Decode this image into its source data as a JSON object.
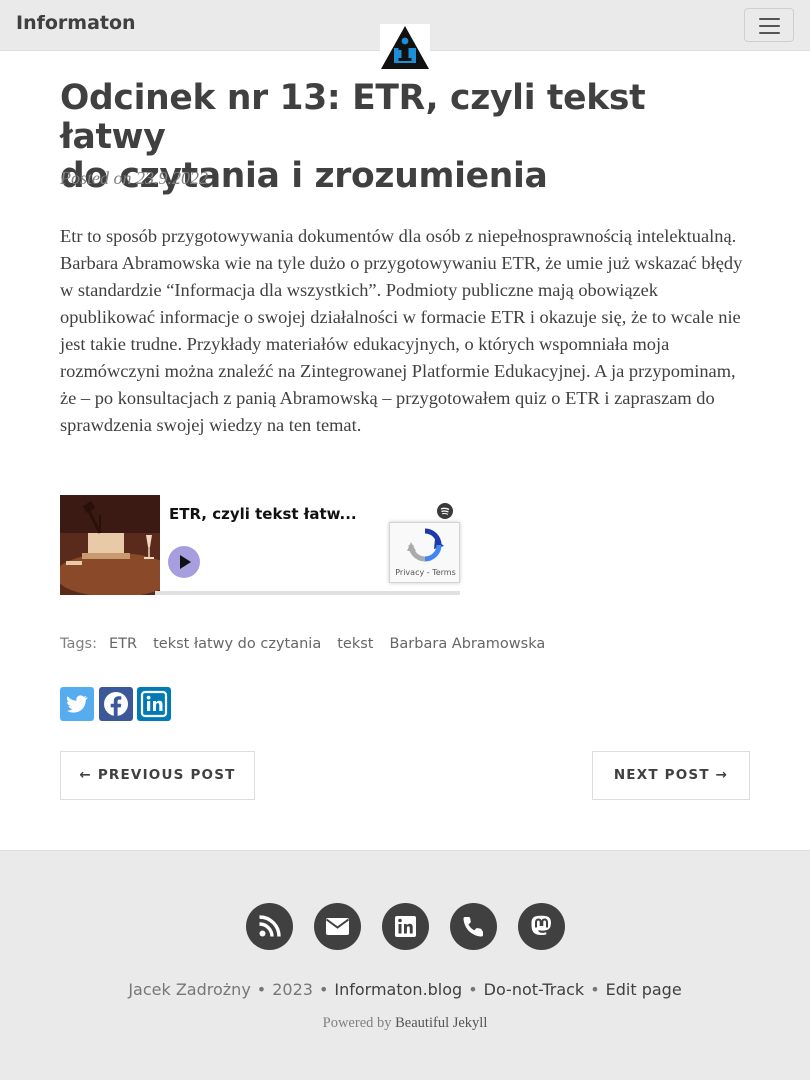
{
  "navbar": {
    "brand": "Informaton",
    "logo_letter": "i",
    "menu_icon": "hamburger-icon"
  },
  "post": {
    "title_line1": "Odcinek nr 13: ETR, czyli tekst łatwy",
    "title_line2": "do czytania i zrozumienia",
    "meta": "Posted on 23.9.2022",
    "body": "Etr to sposób przygotowywania dokumentów dla osób z niepełnosprawnością intelektualną. Barbara Abramowska wie na tyle dużo o przygotowywaniu ETR, że umie już wskazać błędy w standardzie “Informacja dla wszystkich”. Podmioty publiczne mają obowiązek opublikować informacje o swojej działalności w formacie ETR i okazuje się, że to wcale nie jest takie trudne. Przykłady materiałów edukacyjnych, o których wspomniała moja rozmówczyni można znaleźć na Zintegrowanej Platformie Edukacyjnej. A ja przypominam, że – po konsultacjach z panią Abramowską – przygotowałem quiz o ETR i zapraszam do sprawdzenia swojej wiedzy na ten temat."
  },
  "embed": {
    "episode_title": "ETR, czyli tekst łatw...",
    "recaptcha_privacy": "Privacy",
    "recaptcha_sep": " - ",
    "recaptcha_terms": "Terms",
    "icons": [
      "play-icon",
      "spotify-icon",
      "recaptcha-icon"
    ]
  },
  "tags": {
    "label": "Tags:",
    "items": [
      "ETR",
      "tekst łatwy do czytania",
      "tekst",
      "Barbara Abramowska"
    ]
  },
  "share": {
    "icons": [
      "twitter-icon",
      "facebook-icon",
      "linkedin-icon"
    ],
    "colors": {
      "twitter": "#55acee",
      "facebook": "#3b5998",
      "linkedin": "#007bb5"
    }
  },
  "pager": {
    "previous": "← PREVIOUS POST",
    "next": "NEXT POST →"
  },
  "footer": {
    "social_icons": [
      "rss-icon",
      "email-icon",
      "linkedin-icon",
      "phone-icon",
      "mastodon-icon"
    ],
    "author": "Jacek Zadrożny",
    "year": "2023",
    "separator": "•",
    "site": "Informaton.blog",
    "dnt": "Do-not-Track",
    "edit": "Edit page",
    "powered_prefix": "Powered by",
    "powered_link": "Beautiful Jekyll"
  },
  "colors": {
    "navbar_bg": "#eaeaea",
    "text": "#404040",
    "muted": "#808080",
    "logo_blue": "#1e8ed8"
  }
}
